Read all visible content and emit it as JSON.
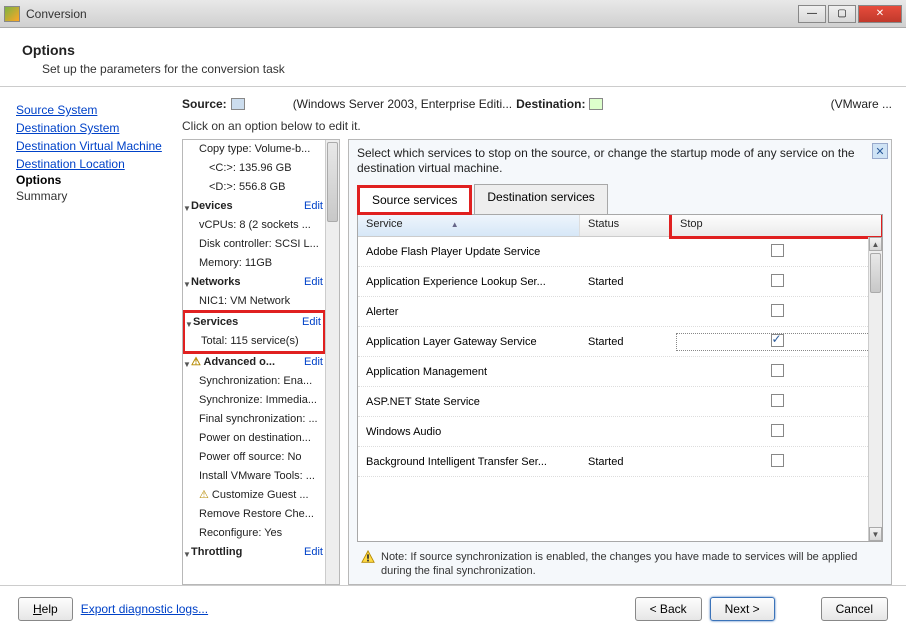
{
  "window": {
    "title": "Conversion"
  },
  "header": {
    "title": "Options",
    "subtitle": "Set up the parameters for the conversion task"
  },
  "nav": {
    "items": [
      {
        "label": "Source System",
        "kind": "link"
      },
      {
        "label": "Destination System",
        "kind": "link"
      },
      {
        "label": "Destination Virtual Machine",
        "kind": "link"
      },
      {
        "label": "Destination Location",
        "kind": "link"
      },
      {
        "label": "Options",
        "kind": "current"
      },
      {
        "label": "Summary",
        "kind": "plain"
      }
    ]
  },
  "source_row": {
    "source_label": "Source:",
    "source_value": "(Windows Server 2003, Enterprise Editi...",
    "dest_label": "Destination:",
    "dest_value": "(VMware ..."
  },
  "hint": "Click on an option below to edit it.",
  "tree": {
    "items": [
      {
        "text": "Copy type: Volume-b...",
        "indent": 1
      },
      {
        "text": "<C:>: 135.96 GB",
        "indent": 2
      },
      {
        "text": "<D:>: 556.8 GB",
        "indent": 2
      },
      {
        "text": "Devices",
        "group": true,
        "edit": "Edit"
      },
      {
        "text": "vCPUs: 8 (2 sockets ...",
        "indent": 1
      },
      {
        "text": "Disk controller: SCSI L...",
        "indent": 1
      },
      {
        "text": "Memory: 11GB",
        "indent": 1
      },
      {
        "text": "Networks",
        "group": true,
        "edit": "Edit"
      },
      {
        "text": "NIC1: VM Network",
        "indent": 1
      },
      {
        "text": "Services",
        "group": true,
        "edit": "Edit",
        "hl_start": true
      },
      {
        "text": "Total: 115 service(s)",
        "indent": 1,
        "hl_end": true
      },
      {
        "text": "Advanced o...",
        "group": true,
        "edit": "Edit",
        "warn": true
      },
      {
        "text": "Synchronization: Ena...",
        "indent": 1
      },
      {
        "text": "Synchronize: Immedia...",
        "indent": 1
      },
      {
        "text": "Final synchronization: ...",
        "indent": 1
      },
      {
        "text": "Power on destination...",
        "indent": 1
      },
      {
        "text": "Power off source: No",
        "indent": 1
      },
      {
        "text": "Install VMware Tools: ...",
        "indent": 1
      },
      {
        "text": "Customize Guest ...",
        "indent": 1,
        "warn": true
      },
      {
        "text": "Remove Restore Che...",
        "indent": 1
      },
      {
        "text": "Reconfigure: Yes",
        "indent": 1
      },
      {
        "text": "Throttling",
        "group": true,
        "edit": "Edit"
      }
    ]
  },
  "detail": {
    "desc": "Select which services to stop on the source, or change the startup mode of any service on the destination virtual machine.",
    "tabs": [
      {
        "label": "Source services",
        "active": true
      },
      {
        "label": "Destination services",
        "active": false
      }
    ],
    "columns": {
      "c1": "Service",
      "c2": "Status",
      "c3": "Stop"
    },
    "rows": [
      {
        "service": "Adobe Flash Player Update Service",
        "status": "",
        "stop": false
      },
      {
        "service": "Application Experience Lookup Ser...",
        "status": "Started",
        "stop": false
      },
      {
        "service": "Alerter",
        "status": "",
        "stop": false
      },
      {
        "service": "Application Layer Gateway Service",
        "status": "Started",
        "stop": true,
        "selected": true
      },
      {
        "service": "Application Management",
        "status": "",
        "stop": false
      },
      {
        "service": "ASP.NET State Service",
        "status": "",
        "stop": false
      },
      {
        "service": "Windows Audio",
        "status": "",
        "stop": false
      },
      {
        "service": "Background Intelligent Transfer Ser...",
        "status": "Started",
        "stop": false
      }
    ],
    "note": "Note: If source synchronization is enabled, the changes you have made to services will be applied during the final synchronization."
  },
  "footer": {
    "help": "Help",
    "export": "Export diagnostic logs...",
    "back": "< Back",
    "next": "Next >",
    "cancel": "Cancel"
  }
}
